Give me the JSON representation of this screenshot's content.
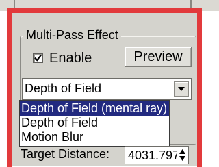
{
  "group": {
    "label": "Multi-Pass Effect"
  },
  "enable": {
    "label": "Enable",
    "checked": true
  },
  "preview_button": {
    "label": "Preview"
  },
  "effect_dropdown": {
    "selected": "Depth of Field",
    "options": [
      "Depth of Field (mental ray)",
      "Depth of Field",
      "Motion Blur"
    ],
    "highlighted_option": "Depth of Field (mental ray)"
  },
  "target_distance": {
    "label": "Target Distance:",
    "value": "4031.797i"
  },
  "colors": {
    "frame": "#e23a3c",
    "panel": "#d4d3cd",
    "selection": "#222a80"
  }
}
